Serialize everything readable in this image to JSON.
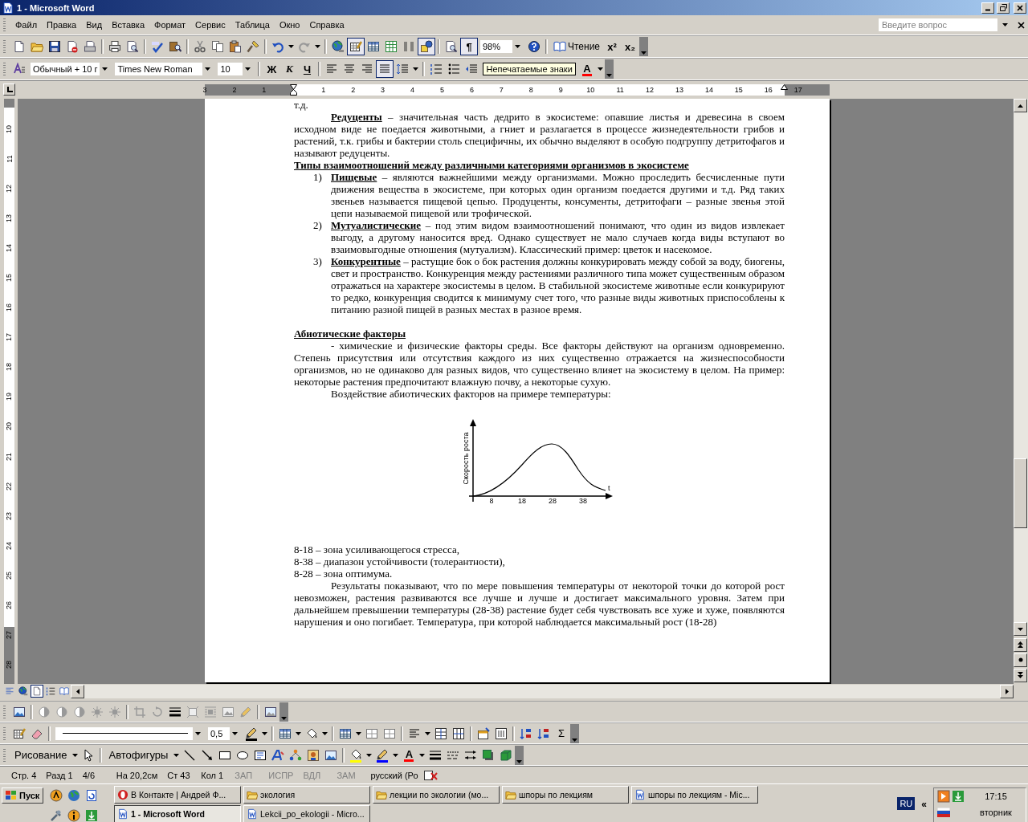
{
  "window": {
    "title": "1 - Microsoft Word"
  },
  "menu": [
    {
      "label": "Файл"
    },
    {
      "label": "Правка"
    },
    {
      "label": "Вид"
    },
    {
      "label": "Вставка"
    },
    {
      "label": "Формат"
    },
    {
      "label": "Сервис"
    },
    {
      "label": "Таблица"
    },
    {
      "label": "Окно"
    },
    {
      "label": "Справка"
    }
  ],
  "help_search": {
    "placeholder": "Введите вопрос"
  },
  "toolbars": [
    {
      "items": [
        {
          "kind": "icon",
          "pressed": false
        },
        {
          "kind": "icon",
          "pressed": false
        },
        {
          "kind": "icon",
          "pressed": false
        },
        {
          "kind": "icon",
          "pressed": false
        },
        {
          "kind": "icon",
          "pressed": false
        },
        {
          "kind": "sep"
        },
        {
          "kind": "icon",
          "pressed": false
        },
        {
          "kind": "icon",
          "pressed": false
        },
        {
          "kind": "sep"
        },
        {
          "kind": "icon",
          "pressed": false
        },
        {
          "kind": "icon",
          "pressed": false
        },
        {
          "kind": "sep"
        },
        {
          "kind": "icon",
          "pressed": false
        },
        {
          "kind": "icon",
          "pressed": false
        },
        {
          "kind": "icon",
          "pressed": false
        },
        {
          "kind": "icon",
          "pressed": false
        },
        {
          "kind": "sep"
        },
        {
          "kind": "icon",
          "pressed": false,
          "menu": true
        },
        {
          "kind": "icon",
          "pressed": false,
          "menu": true
        },
        {
          "kind": "sep"
        },
        {
          "kind": "icon",
          "pressed": false
        },
        {
          "kind": "icon",
          "pressed": true
        },
        {
          "kind": "icon",
          "pressed": false
        },
        {
          "kind": "icon",
          "pressed": false
        },
        {
          "kind": "icon",
          "pressed": false
        },
        {
          "kind": "icon",
          "pressed": true
        },
        {
          "kind": "sep"
        },
        {
          "kind": "icon",
          "pressed": false
        },
        {
          "kind": "text",
          "label": "¶",
          "pressed": true
        },
        {
          "kind": "combo",
          "value": "98%"
        },
        {
          "kind": "icon",
          "pressed": false
        },
        {
          "kind": "sep"
        },
        {
          "kind": "labeled",
          "label": "Чтение",
          "pressed": false
        },
        {
          "kind": "text",
          "label": "x²",
          "pressed": false
        },
        {
          "kind": "text",
          "label": "x₂",
          "pressed": false
        }
      ]
    },
    {
      "items": [
        {
          "kind": "icon",
          "pressed": false
        },
        {
          "kind": "combo",
          "value": "Обычный + 10 г"
        },
        {
          "kind": "combo",
          "value": "Times New Roman"
        },
        {
          "kind": "combo",
          "value": "10"
        },
        {
          "kind": "sep"
        },
        {
          "kind": "text",
          "label": "Ж",
          "pressed": false
        },
        {
          "kind": "text",
          "label": "К",
          "pressed": false
        },
        {
          "kind": "text",
          "label": "Ч",
          "pressed": false
        },
        {
          "kind": "sep"
        },
        {
          "kind": "icon",
          "pressed": false
        },
        {
          "kind": "icon",
          "pressed": false
        },
        {
          "kind": "icon",
          "pressed": false
        },
        {
          "kind": "icon",
          "pressed": true
        },
        {
          "kind": "icon",
          "pressed": false,
          "menu": true
        },
        {
          "kind": "sep"
        },
        {
          "kind": "icon",
          "pressed": false
        },
        {
          "kind": "icon",
          "pressed": false
        },
        {
          "kind": "icon",
          "pressed": false
        },
        {
          "kind": "tooltip",
          "label": "Непечатаемые знаки"
        },
        {
          "kind": "text",
          "label": "A",
          "pressed": false,
          "menu": true,
          "color": "#ff0000"
        }
      ]
    },
    {
      "items": [
        {
          "kind": "icon",
          "pressed": false
        },
        {
          "kind": "sep"
        },
        {
          "kind": "icon",
          "pressed": false
        },
        {
          "kind": "icon",
          "pressed": false
        },
        {
          "kind": "icon",
          "pressed": false
        },
        {
          "kind": "icon",
          "pressed": false
        },
        {
          "kind": "icon",
          "pressed": false
        },
        {
          "kind": "sep"
        },
        {
          "kind": "icon",
          "pressed": false
        },
        {
          "kind": "icon",
          "pressed": false
        },
        {
          "kind": "icon",
          "pressed": false
        },
        {
          "kind": "icon",
          "pressed": false
        },
        {
          "kind": "icon",
          "pressed": false
        },
        {
          "kind": "icon",
          "pressed": false
        },
        {
          "kind": "icon",
          "pressed": false
        },
        {
          "kind": "sep"
        },
        {
          "kind": "icon",
          "pressed": false
        }
      ]
    },
    {
      "items": [
        {
          "kind": "icon",
          "pressed": false
        },
        {
          "kind": "icon",
          "pressed": false
        },
        {
          "kind": "sep"
        },
        {
          "kind": "linecombo"
        },
        {
          "kind": "combo",
          "value": "0,5"
        },
        {
          "kind": "icon",
          "pressed": false,
          "menu": true,
          "color": "#000000"
        },
        {
          "kind": "sep"
        },
        {
          "kind": "icon",
          "pressed": false,
          "menu": true
        },
        {
          "kind": "icon",
          "pressed": false,
          "menu": true
        },
        {
          "kind": "sep"
        },
        {
          "kind": "icon",
          "pressed": false,
          "menu": true
        },
        {
          "kind": "icon",
          "pressed": false
        },
        {
          "kind": "icon",
          "pressed": false
        },
        {
          "kind": "sep"
        },
        {
          "kind": "icon",
          "pressed": false,
          "menu": true
        },
        {
          "kind": "icon",
          "pressed": false
        },
        {
          "kind": "icon",
          "pressed": false
        },
        {
          "kind": "sep"
        },
        {
          "kind": "icon",
          "pressed": false
        },
        {
          "kind": "icon",
          "pressed": false
        },
        {
          "kind": "sep"
        },
        {
          "kind": "icon",
          "pressed": false
        },
        {
          "kind": "icon",
          "pressed": false
        },
        {
          "kind": "text",
          "label": "Σ",
          "pressed": false
        }
      ]
    },
    {
      "items": [
        {
          "kind": "text",
          "label": "Рисование",
          "pressed": false,
          "menu": true
        },
        {
          "kind": "icon",
          "pressed": false
        },
        {
          "kind": "sep"
        },
        {
          "kind": "text",
          "label": "Автофигуры",
          "pressed": false,
          "menu": true
        },
        {
          "kind": "icon",
          "pressed": false
        },
        {
          "kind": "icon",
          "pressed": false
        },
        {
          "kind": "icon",
          "pressed": false
        },
        {
          "kind": "icon",
          "pressed": false
        },
        {
          "kind": "icon",
          "pressed": false
        },
        {
          "kind": "icon",
          "pressed": false
        },
        {
          "kind": "icon",
          "pressed": false
        },
        {
          "kind": "icon",
          "pressed": false
        },
        {
          "kind": "icon",
          "pressed": false
        },
        {
          "kind": "sep"
        },
        {
          "kind": "icon",
          "pressed": false,
          "menu": true,
          "color": "#ffff00"
        },
        {
          "kind": "icon",
          "pressed": false,
          "menu": true,
          "color": "#0000ff"
        },
        {
          "kind": "text",
          "label": "A",
          "pressed": false,
          "menu": true,
          "color": "#ff0000"
        },
        {
          "kind": "icon",
          "pressed": false
        },
        {
          "kind": "icon",
          "pressed": false
        },
        {
          "kind": "icon",
          "pressed": false
        },
        {
          "kind": "icon",
          "pressed": false
        },
        {
          "kind": "icon",
          "pressed": false
        }
      ]
    }
  ],
  "ruler": {
    "left_numbers": [
      "3",
      "2",
      "1"
    ],
    "numbers": [
      "1",
      "2",
      "3",
      "4",
      "5",
      "6",
      "7",
      "8",
      "9",
      "10",
      "11",
      "12",
      "13",
      "14",
      "15",
      "16",
      "17"
    ]
  },
  "vertical_ruler": {
    "numbers": [
      "10",
      "11",
      "12",
      "13",
      "14",
      "15",
      "16",
      "17",
      "18",
      "19",
      "20",
      "21",
      "22",
      "23",
      "24",
      "25",
      "26",
      "27",
      "28"
    ]
  },
  "document": [
    {
      "kind": "plain",
      "text": "т.д."
    },
    {
      "kind": "para",
      "text": "**Редуценты** – значительная часть дедрито в экосистеме: опавшие листья и древесина в своем исходном виде не поедается животными, а гниет и разлагается в процессе жизнедеятельности грибов и растений, т.к. грибы и бактерии столь специфичны, их обычно выделяют в особую подгруппу детритофагов и называют редуценты."
    },
    {
      "kind": "heading",
      "text": "Типы взаимоотношений между различными категориями организмов в экосистеме",
      "blank_line_before": false
    },
    {
      "kind": "numbered",
      "number": "1)",
      "text": "**Пищевые** – являются важнейшими между организмами. Можно проследить бесчисленные пути движения вещества в экосистеме, при которых один организм поедается другими и т.д. Ряд таких звеньев называется пищевой цепью. Продуценты, консументы, детритофаги – разные звенья этой цепи называемой пищевой или трофической."
    },
    {
      "kind": "numbered",
      "number": "2)",
      "text": "**Мутуалистические** – под этим  видом взаимоотношений понимают, что один из видов извлекает выгоду, а другому наносится вред. Однако существует не мало случаев когда виды вступают во взаимовыгодные отношения (мутуализм). Классический пример: цветок и насекомое."
    },
    {
      "kind": "numbered",
      "number": "3)",
      "text": "**Конкурентные** – растущие бок о бок растения должны конкурировать между собой за воду, биогены, свет и пространство. Конкуренция между растениями различного типа  может существенным образом отражаться на характере экосистемы в целом. В стабильной экосистеме животные если конкурируют то редко, конкуренция сводится к минимуму счет того, что разные виды животных приспособлены к питанию разной пищей в разных местах в разное время."
    },
    {
      "kind": "heading",
      "text": "Абиотические факторы",
      "blank_line_before": true
    },
    {
      "kind": "para",
      "text": "- химические и физические факторы среды. Все факторы действуют на организм одновременно. Степень присутствия или отсутствия каждого из них существенно отражается на жизнеспособности организмов, но не одинаково для разных видов, что существенно влияет на экосистему в целом. На пример: некоторые растения предпочитают влажную почву, а некоторые сухую."
    },
    {
      "kind": "para",
      "text": "Воздействие абиотических факторов на примере температуры:"
    },
    {
      "kind": "figure",
      "ylabel": "Скорость роста",
      "xlabel": "t",
      "xticks": [
        "8",
        "18",
        "28",
        "38"
      ]
    },
    {
      "kind": "plain",
      "text": "8-18 – зона усиливающегося стресса,"
    },
    {
      "kind": "plain",
      "text": "8-38 – диапазон устойчивости (толерантности),"
    },
    {
      "kind": "plain",
      "text": "8-28 – зона оптимума."
    },
    {
      "kind": "para",
      "text": "Результаты показывают, что по мере повышения температуры от некоторой точки до которой рост невозможен, растения развиваются все лучше и лучше и достигает максимального уровня. Затем при дальнейшем превышении температуры (28-38) растение будет себя чувствовать все хуже и хуже, появляются нарушения и оно погибает. Температура, при которой наблюдается максимальный рост (18-28)"
    }
  ],
  "view_buttons": [
    {
      "selected": false
    },
    {
      "selected": false
    },
    {
      "selected": true
    },
    {
      "selected": false
    },
    {
      "selected": false
    }
  ],
  "status_bar": [
    {
      "text": "Стр. 4",
      "active": true
    },
    {
      "text": "Разд 1",
      "active": true
    },
    {
      "text": "4/6",
      "active": true
    },
    {
      "text": "На 20,2см",
      "active": true
    },
    {
      "text": "Ст 43",
      "active": true
    },
    {
      "text": "Кол 1",
      "active": true
    },
    {
      "text": "ЗАП",
      "active": false
    },
    {
      "text": "ИСПР",
      "active": false
    },
    {
      "text": "ВДЛ",
      "active": false
    },
    {
      "text": "ЗАМ",
      "active": false
    },
    {
      "text": "русский (Ро",
      "active": true
    }
  ],
  "taskbar": {
    "start": "Пуск",
    "tasks": [
      {
        "kind": "browser",
        "label": "В Контакте | Андрей Ф...",
        "selected": false
      },
      {
        "kind": "folder",
        "label": "экология",
        "selected": false
      },
      {
        "kind": "folder",
        "label": "лекции по экологии (мо...",
        "selected": false
      },
      {
        "kind": "folder",
        "label": "шпоры по лекциям",
        "selected": false
      },
      {
        "kind": "word",
        "label": "шпоры по лекциям - Mic...",
        "selected": false
      },
      {
        "kind": "word",
        "label": "1 - Microsoft Word",
        "selected": true
      },
      {
        "kind": "word",
        "label": "Lekcii_po_ekologii - Micro...",
        "selected": false
      }
    ],
    "language": "RU",
    "chevron": "«",
    "time": "17:15",
    "day": "вторник"
  }
}
